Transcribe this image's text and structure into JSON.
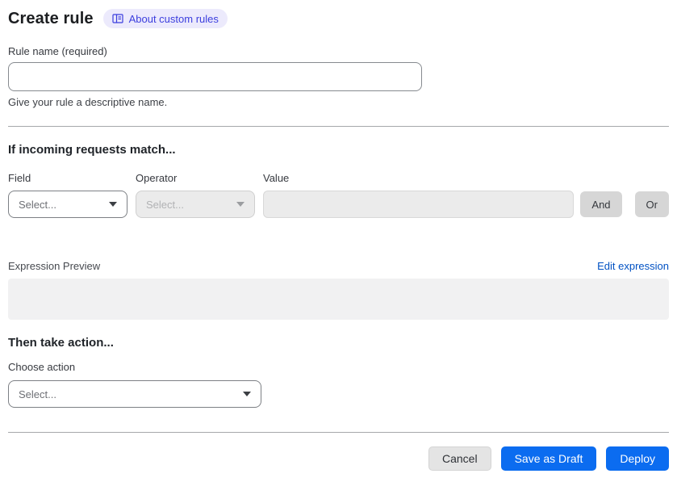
{
  "header": {
    "title": "Create rule",
    "badge": {
      "label": "About custom rules",
      "icon": "book-icon"
    }
  },
  "rule_name": {
    "label": "Rule name (required)",
    "value": "",
    "placeholder": "",
    "helper": "Give your rule a descriptive name."
  },
  "match_section": {
    "heading": "If incoming requests match...",
    "field": {
      "label": "Field",
      "selected": "Select..."
    },
    "operator": {
      "label": "Operator",
      "selected": "Select..."
    },
    "value": {
      "label": "Value",
      "value": "",
      "placeholder": ""
    },
    "and_label": "And",
    "or_label": "Or",
    "expression_preview_label": "Expression Preview",
    "edit_expression_label": "Edit expression",
    "expression_value": ""
  },
  "action_section": {
    "heading": "Then take action...",
    "choose_label": "Choose action",
    "selected": "Select..."
  },
  "footer": {
    "cancel_label": "Cancel",
    "save_draft_label": "Save as Draft",
    "deploy_label": "Deploy"
  },
  "colors": {
    "primary_button": "#0b6cf0",
    "link": "#0051c3",
    "badge_bg": "#eceafc",
    "badge_text": "#3b3ede",
    "disabled_bg": "#ebebeb",
    "conjunction_bg": "#d6d6d6"
  }
}
